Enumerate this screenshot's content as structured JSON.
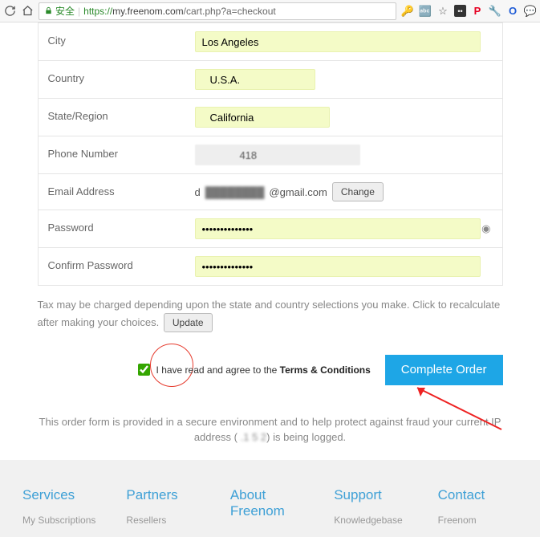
{
  "browser": {
    "secure_label": "安全",
    "url_prefix": "https://",
    "url_host": "my.freenom.com",
    "url_path": "/cart.php?a=checkout"
  },
  "form": {
    "city": {
      "label": "City",
      "value": "Los Angeles"
    },
    "country": {
      "label": "Country",
      "value": "U.S.A."
    },
    "state": {
      "label": "State/Region",
      "value": "California"
    },
    "phone": {
      "label": "Phone Number",
      "value": "             418"
    },
    "email": {
      "label": "Email Address",
      "prefix": "d",
      "masked": "████████",
      "suffix": "@gmail.com",
      "change": "Change"
    },
    "password": {
      "label": "Password",
      "value": "••••••••••••••"
    },
    "confirm": {
      "label": "Confirm Password",
      "value": "••••••••••••••"
    }
  },
  "tax_note": "Tax may be charged depending upon the state and country selections you make. Click to recalculate after making your choices.",
  "update_btn": "Update",
  "agree_text": "I have read and agree to the ",
  "agree_link": "Terms & Conditions",
  "complete_btn": "Complete Order",
  "secure_note_pre": "This order form is provided in a secure environment and to help protect against fraud your current IP address (",
  "ip_masked": "   .1      5     2",
  "secure_note_post": ") is being logged.",
  "footer": {
    "services": {
      "title": "Services",
      "link1": "My Subscriptions"
    },
    "partners": {
      "title": "Partners",
      "link1": "Resellers"
    },
    "about": {
      "title": "About Freenom"
    },
    "support": {
      "title": "Support",
      "link1": "Knowledgebase"
    },
    "contact": {
      "title": "Contact",
      "link1": "Freenom"
    }
  }
}
